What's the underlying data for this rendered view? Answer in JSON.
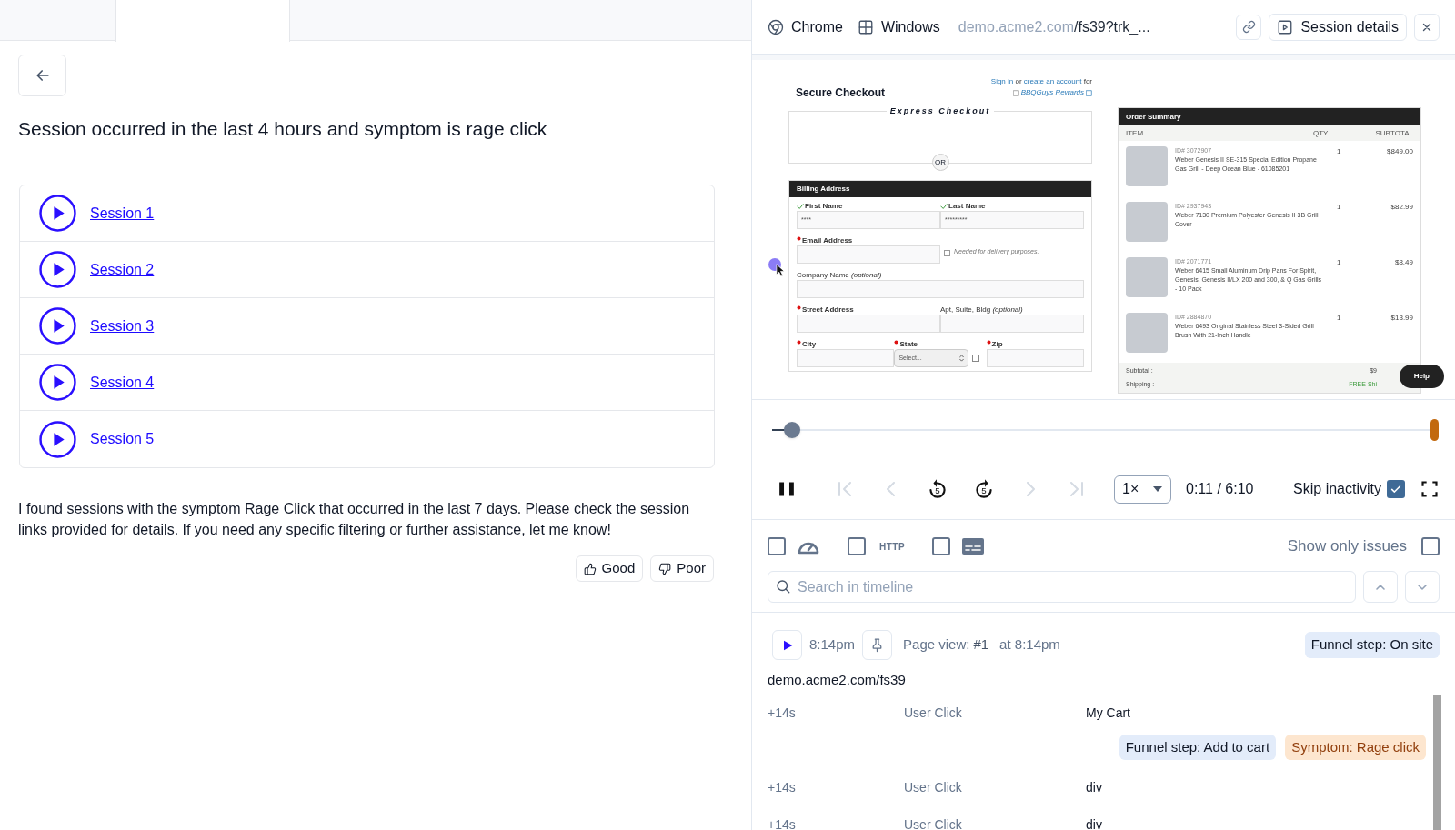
{
  "tabs": [
    {
      "selected": false
    },
    {
      "selected": true
    },
    {
      "selected": false
    }
  ],
  "heading": "Session occurred in the last 4 hours and symptom is rage click",
  "sessions": [
    {
      "label": "Session 1"
    },
    {
      "label": "Session 2"
    },
    {
      "label": "Session 3"
    },
    {
      "label": "Session 4"
    },
    {
      "label": "Session 5"
    }
  ],
  "message": "I found sessions with the symptom Rage Click that occurred in the last 7 days. Please check the session links provided for details. If you need any specific filtering or further assistance, let me know!",
  "feedback": [
    {
      "kind": "up",
      "label": "Good"
    },
    {
      "kind": "down",
      "label": "Poor"
    }
  ],
  "player": {
    "browser": "Chrome",
    "os": "Windows",
    "url_host": "demo.acme2.com",
    "url_path": "/fs39?trk_...",
    "details_button": "Session details"
  },
  "replay": {
    "title": "Secure Checkout",
    "prompt": [
      {
        "text": "Sign in",
        "link": true
      },
      {
        "text": " or ",
        "link": false
      },
      {
        "text": "create an account",
        "link": true
      },
      {
        "text": " for",
        "link": false
      }
    ],
    "rewards": "BBQGuys Rewards",
    "express": "Express Checkout",
    "or": "OR",
    "billing_title": "Billing Address",
    "rows": [
      [
        {
          "label": "First Name",
          "valid": true,
          "required": false,
          "kind": "text",
          "value": "****"
        },
        {
          "label": "Last Name",
          "valid": true,
          "required": false,
          "kind": "text",
          "value": "*********"
        }
      ],
      [
        {
          "label": "Email Address",
          "valid": false,
          "required": true,
          "kind": "text",
          "note": "Needed for delivery purposes.",
          "checked": false
        }
      ],
      [
        {
          "label": "Company Name *(optional)*",
          "valid": false,
          "required": false,
          "kind": "text"
        }
      ],
      [
        {
          "label": "Street Address",
          "valid": false,
          "required": true,
          "kind": "text"
        },
        {
          "label": "Apt, Suite, Bldg *(optional)*",
          "valid": false,
          "required": false,
          "kind": "text"
        }
      ],
      [
        {
          "label": "City",
          "valid": false,
          "required": true,
          "kind": "text"
        },
        {
          "label": "State",
          "valid": false,
          "required": true,
          "kind": "select",
          "value": "Select...",
          "checked": false
        },
        {
          "label": "Zip",
          "valid": false,
          "required": true,
          "kind": "text"
        }
      ]
    ],
    "summary": {
      "title": "Order Summary",
      "columns": [
        "ITEM",
        "QTY",
        "SUBTOTAL"
      ],
      "items": [
        {
          "id": "ID# 3072907",
          "name": "Weber Genesis II SE-315 Special Edition Propane Gas Grill - Deep Ocean Blue - 61085201",
          "qty": "1",
          "price": "$849.00"
        },
        {
          "id": "ID# 2937943",
          "name": "Weber 7130 Premium Polyester Genesis II 3B Grill Cover",
          "qty": "1",
          "price": "$82.99"
        },
        {
          "id": "ID# 2071771",
          "name": "Weber 6415 Small Aluminum Drip Pans For Spirit, Genesis, Genesis II/LX 200 and 300, & Q Gas Grills - 10 Pack",
          "qty": "1",
          "price": "$8.49"
        },
        {
          "id": "ID# 2884870",
          "name": "Weber 6493 Original Stainless Steel 3-Sided Grill Brush With 21-Inch Handle",
          "qty": "1",
          "price": "$13.99"
        }
      ],
      "totals": [
        {
          "label": "Subtotal :",
          "value": "$9",
          "kind": "plain"
        },
        {
          "label": "Shipping :",
          "value": "FREE Shi",
          "kind": "free"
        }
      ]
    },
    "help": "Help"
  },
  "slider": {
    "level": 0.03
  },
  "controls": {
    "buttons": [
      {
        "kind": "pause",
        "disabled": false
      },
      {
        "kind": "first",
        "disabled": true
      },
      {
        "kind": "prev",
        "disabled": true
      },
      {
        "kind": "back5",
        "disabled": false,
        "label": "5"
      },
      {
        "kind": "fwd5",
        "disabled": false,
        "label": "5"
      },
      {
        "kind": "next",
        "disabled": true
      },
      {
        "kind": "last",
        "disabled": true
      }
    ],
    "speed": "1×",
    "time": "0:11 / 6:10",
    "skip_label": "Skip inactivity",
    "skip_checked": true
  },
  "filters": [
    {
      "kind": "performance",
      "checked": false
    },
    {
      "kind": "http",
      "label": "HTTP",
      "checked": false
    },
    {
      "kind": "console",
      "checked": false
    }
  ],
  "issues_filter": {
    "label": "Show only issues",
    "checked": false
  },
  "search": {
    "placeholder": "Search in timeline"
  },
  "page_view": {
    "time": "8:14pm",
    "label": "Page view:",
    "number": "#1",
    "at": "at 8:14pm",
    "badge": "Funnel step: On site",
    "url": "demo.acme2.com/fs39"
  },
  "events": [
    {
      "offset": "+14s",
      "type": "User Click",
      "target": "My Cart",
      "tags": [
        {
          "kind": "funnel",
          "text": "Funnel step: Add to cart"
        },
        {
          "kind": "symptom",
          "text": "Symptom: Rage click"
        }
      ]
    },
    {
      "offset": "+14s",
      "type": "User Click",
      "target": "div"
    },
    {
      "offset": "+14s",
      "type": "User Click",
      "target": "div"
    }
  ]
}
